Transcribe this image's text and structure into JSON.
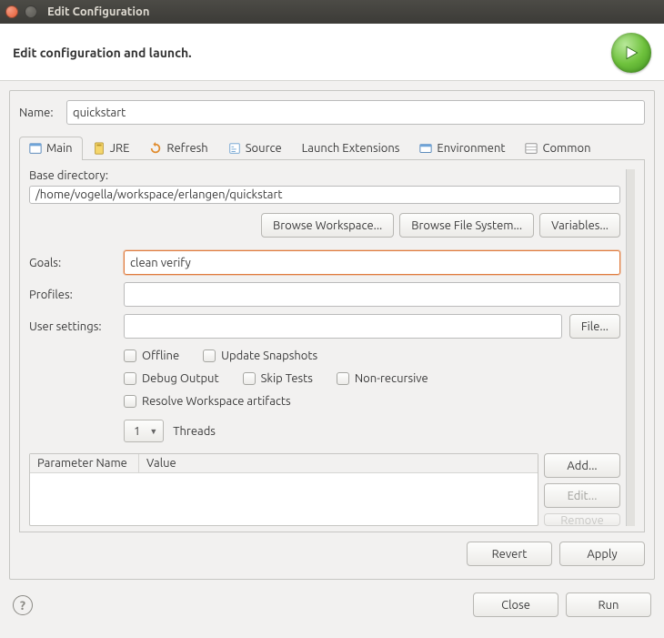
{
  "window": {
    "title": "Edit Configuration"
  },
  "header": {
    "title": "Edit configuration and launch."
  },
  "name": {
    "label": "Name:",
    "value": "quickstart"
  },
  "tabs": [
    {
      "label": "Main"
    },
    {
      "label": "JRE"
    },
    {
      "label": "Refresh"
    },
    {
      "label": "Source"
    },
    {
      "label": "Launch Extensions"
    },
    {
      "label": "Environment"
    },
    {
      "label": "Common"
    }
  ],
  "main": {
    "base_dir": {
      "label": "Base directory:",
      "value": "/home/vogella/workspace/erlangen/quickstart"
    },
    "browse_workspace": "Browse Workspace...",
    "browse_fs": "Browse File System...",
    "variables": "Variables...",
    "goals": {
      "label": "Goals:",
      "value": "clean verify"
    },
    "profiles": {
      "label": "Profiles:",
      "value": ""
    },
    "user_settings": {
      "label": "User settings:",
      "value": "",
      "file_btn": "File..."
    },
    "checks": {
      "offline": "Offline",
      "update_snapshots": "Update Snapshots",
      "debug_output": "Debug Output",
      "skip_tests": "Skip Tests",
      "non_recursive": "Non-recursive",
      "resolve_ws": "Resolve Workspace artifacts"
    },
    "threads": {
      "value": "1",
      "label": "Threads"
    },
    "params": {
      "col_name": "Parameter Name",
      "col_value": "Value",
      "add": "Add...",
      "edit": "Edit...",
      "remove": "Remove"
    },
    "revert": "Revert",
    "apply": "Apply"
  },
  "footer": {
    "close": "Close",
    "run": "Run"
  }
}
